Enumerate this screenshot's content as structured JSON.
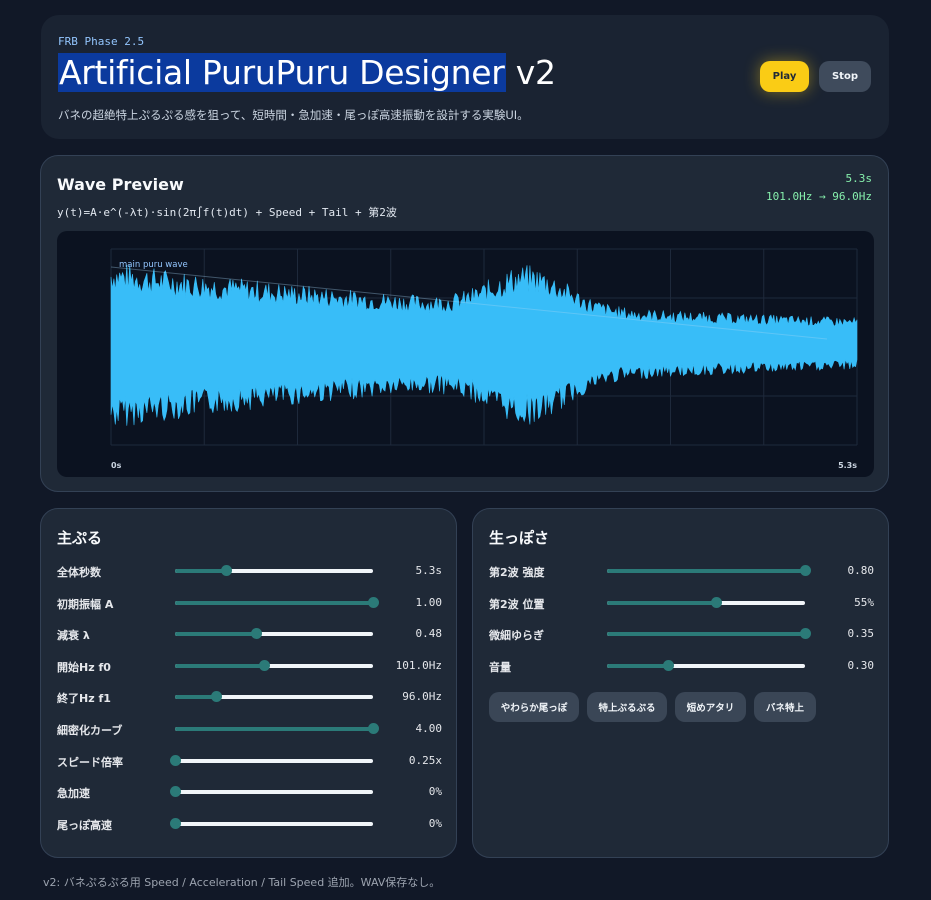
{
  "header": {
    "phase": "FRB Phase 2.5",
    "title_highlight": "Artificial PuruPuru Designer",
    "title_rest": " v2",
    "subtitle": "バネの超絶特上ぷるぷる感を狙って、短時間・急加速・尾っぽ高速振動を設計する実験UI。",
    "play_label": "Play",
    "stop_label": "Stop"
  },
  "preview": {
    "title": "Wave Preview",
    "formula": "y(t)=A·e^(-λt)·sin(2π∫f(t)dt) + Speed + Tail + 第2波",
    "duration": "5.3s",
    "freq_range": "101.0Hz → 96.0Hz",
    "legend": "main puru wave",
    "axis_start": "0s",
    "axis_end": "5.3s"
  },
  "left_panel": {
    "title": "主ぷる",
    "sliders": [
      {
        "label": "全体秒数",
        "value": "5.3s",
        "fraction": 0.26
      },
      {
        "label": "初期振幅 A",
        "value": "1.00",
        "fraction": 1.0
      },
      {
        "label": "減衰 λ",
        "value": "0.48",
        "fraction": 0.41
      },
      {
        "label": "開始Hz f0",
        "value": "101.0Hz",
        "fraction": 0.45
      },
      {
        "label": "終了Hz f1",
        "value": "96.0Hz",
        "fraction": 0.205
      },
      {
        "label": "細密化カーブ",
        "value": "4.00",
        "fraction": 1.0
      },
      {
        "label": "スピード倍率",
        "value": "0.25x",
        "fraction": 0.0
      },
      {
        "label": "急加速",
        "value": "0%",
        "fraction": 0.0
      },
      {
        "label": "尾っぽ高速",
        "value": "0%",
        "fraction": 0.0
      }
    ]
  },
  "right_panel": {
    "title": "生っぽさ",
    "sliders": [
      {
        "label": "第2波 強度",
        "value": "0.80",
        "fraction": 1.0
      },
      {
        "label": "第2波 位置",
        "value": "55%",
        "fraction": 0.55
      },
      {
        "label": "微細ゆらぎ",
        "value": "0.35",
        "fraction": 1.0
      },
      {
        "label": "音量",
        "value": "0.30",
        "fraction": 0.31
      }
    ],
    "presets": [
      "やわらか尾っぽ",
      "特上ぷるぷる",
      "短めアタリ",
      "バネ特上"
    ]
  },
  "footer": "v2: バネぷるぷる用 Speed / Acceleration / Tail Speed 追加。WAV保存なし。",
  "colors": {
    "background": "#111827",
    "card": "#1f2937",
    "accent_play": "#facc15",
    "wave": "#38bdf8",
    "slider_fill": "#2b7a78",
    "stat_text": "#86efac",
    "phase_text": "#93c5fd"
  }
}
